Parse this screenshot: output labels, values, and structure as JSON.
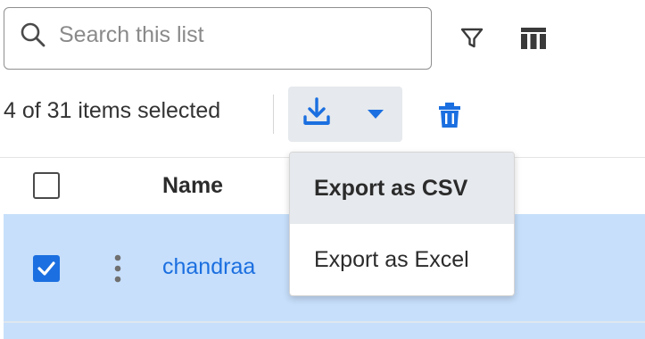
{
  "search": {
    "placeholder": "Search this list",
    "value": ""
  },
  "toolbar": {
    "icons": [
      "search-icon",
      "filter-icon",
      "columns-icon",
      "download-icon",
      "chevron-down-icon",
      "trash-icon"
    ]
  },
  "selection": {
    "text": "4 of 31 items selected"
  },
  "export_menu": {
    "items": [
      {
        "label": "Export as CSV",
        "highlighted": true
      },
      {
        "label": "Export as Excel",
        "highlighted": false
      }
    ]
  },
  "table": {
    "columns": [
      {
        "label": "Name"
      }
    ],
    "rows": [
      {
        "name": "chandraa",
        "selected": true
      }
    ]
  },
  "colors": {
    "accent": "#1b6fe0",
    "selected_row": "#c7dffb",
    "button_bg": "#e6e9ed"
  }
}
